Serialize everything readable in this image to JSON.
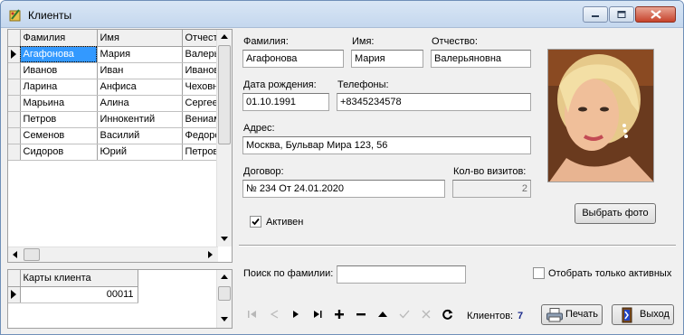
{
  "window": {
    "title": "Клиенты"
  },
  "clients_grid": {
    "columns": [
      "Фамилия",
      "Имя",
      "Отчество"
    ],
    "rows": [
      [
        "Агафонова",
        "Мария",
        "Валерьяновна"
      ],
      [
        "Иванов",
        "Иван",
        "Иванович"
      ],
      [
        "Ларина",
        "Анфиса",
        "Чеховна"
      ],
      [
        "Марьина",
        "Алина",
        "Сергеевна"
      ],
      [
        "Петров",
        "Иннокентий",
        "Вениаминович"
      ],
      [
        "Семенов",
        "Василий",
        "Федорович"
      ],
      [
        "Сидоров",
        "Юрий",
        "Петрович"
      ]
    ],
    "selected_row": 0
  },
  "cards_grid": {
    "columns": [
      "Карты клиента"
    ],
    "rows": [
      [
        "00011"
      ]
    ]
  },
  "form": {
    "surname_label": "Фамилия:",
    "surname_value": "Агафонова",
    "name_label": "Имя:",
    "name_value": "Мария",
    "patronymic_label": "Отчество:",
    "patronymic_value": "Валерьяновна",
    "birthdate_label": "Дата рождения:",
    "birthdate_value": "01.10.1991",
    "phones_label": "Телефоны:",
    "phones_value": "+8345234578",
    "address_label": "Адрес:",
    "address_value": "Москва, Бульвар Мира 123, 56",
    "contract_label": "Договор:",
    "contract_value": "№ 234 От 24.01.2020",
    "visits_label": "Кол-во визитов:",
    "visits_value": "2",
    "active_label": "Активен",
    "active_checked": true,
    "choose_photo_label": "Выбрать фото"
  },
  "search": {
    "label": "Поиск по фамилии:",
    "value": "",
    "only_active_label": "Отобрать только активных",
    "only_active_checked": false
  },
  "footer": {
    "clients_label": "Клиентов:",
    "clients_count": "7",
    "print_label": "Печать",
    "exit_label": "Выход"
  },
  "colors": {
    "selection": "#3399ff",
    "count_text": "#1a2a8c",
    "titlebar": "#c4d7ee"
  }
}
